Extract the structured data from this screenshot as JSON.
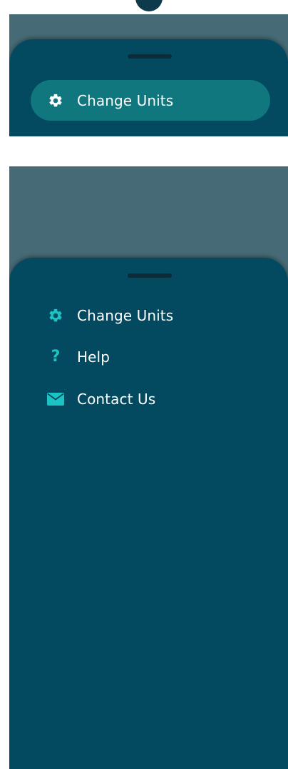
{
  "colors": {
    "backdrop": "#466b76",
    "sheet": "#034a61",
    "handle": "#0d2c38",
    "highlight": "#10777e",
    "icon_accent": "#1cc3c4",
    "label_text": "#ffffff"
  },
  "selected_menu": {
    "label": "Change Units",
    "icon": "gear-icon"
  },
  "menu": {
    "items": [
      {
        "label": "Change Units",
        "icon": "gear-icon"
      },
      {
        "label": "Help",
        "icon": "question-icon"
      },
      {
        "label": "Contact Us",
        "icon": "envelope-icon"
      }
    ]
  }
}
